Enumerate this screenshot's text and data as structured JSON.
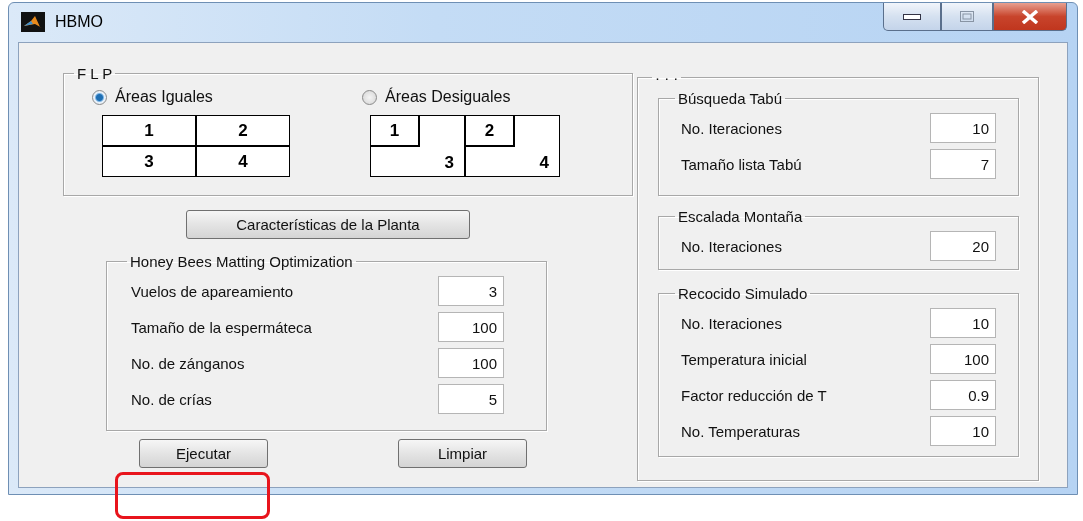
{
  "window": {
    "title": "HBMO"
  },
  "flp": {
    "title": "F L P",
    "options": [
      {
        "label": "Áreas Iguales",
        "selected": true,
        "kind": "equal",
        "cells": [
          "1",
          "2",
          "3",
          "4"
        ]
      },
      {
        "label": "Áreas Desiguales",
        "selected": false,
        "kind": "unequal",
        "cells": [
          "1",
          "2",
          "3",
          "4"
        ]
      }
    ]
  },
  "plant_button": "Características de la Planta",
  "hbmo": {
    "title": "Honey Bees Matting Optimization",
    "fields": [
      {
        "label": "Vuelos de apareamiento",
        "value": "3"
      },
      {
        "label": "Tamaño de la espermáteca",
        "value": "100"
      },
      {
        "label": "No. de zánganos",
        "value": "100"
      },
      {
        "label": "No. de crías",
        "value": "5"
      }
    ]
  },
  "buttons": [
    "Ejecutar",
    "Limpiar"
  ],
  "right_panel": {
    "title": "· · ·",
    "groups": [
      {
        "title": "Búsqueda Tabú",
        "fields": [
          {
            "label": "No. Iteraciones",
            "value": "10"
          },
          {
            "label": "Tamaño lista Tabú",
            "value": "7"
          }
        ]
      },
      {
        "title": "Escalada Montaña",
        "fields": [
          {
            "label": "No. Iteraciones",
            "value": "20"
          }
        ]
      },
      {
        "title": "Recocido Simulado",
        "fields": [
          {
            "label": "No. Iteraciones",
            "value": "10"
          },
          {
            "label": "Temperatura inicial",
            "value": "100"
          },
          {
            "label": "Factor reducción de T",
            "value": "0.9"
          },
          {
            "label": "No. Temperaturas",
            "value": "10"
          }
        ]
      }
    ]
  },
  "annotation": {
    "kind": "rectangle"
  }
}
